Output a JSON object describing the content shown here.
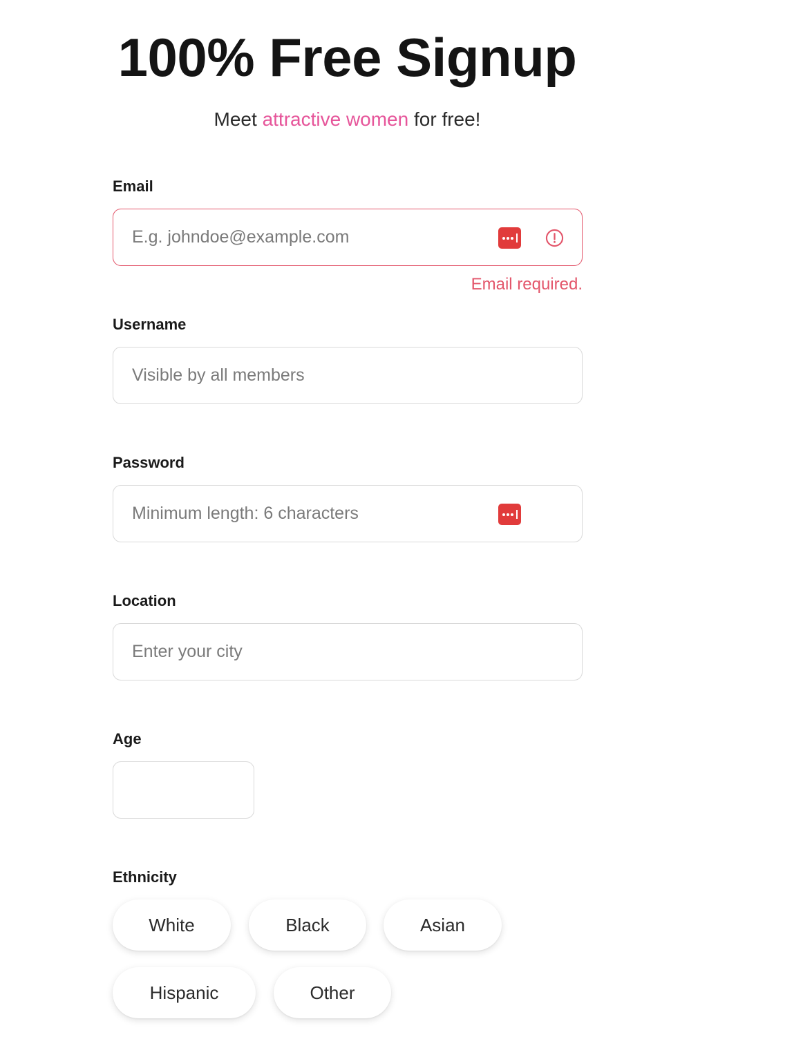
{
  "header": {
    "title": "100% Free Signup",
    "subtitle_prefix": "Meet ",
    "subtitle_accent": "attractive women",
    "subtitle_suffix": " for free!"
  },
  "form": {
    "email": {
      "label": "Email",
      "placeholder": "E.g. johndoe@example.com",
      "value": "",
      "error": "Email required."
    },
    "username": {
      "label": "Username",
      "placeholder": "Visible by all members",
      "value": ""
    },
    "password": {
      "label": "Password",
      "placeholder": "Minimum length: 6 characters",
      "value": ""
    },
    "location": {
      "label": "Location",
      "placeholder": "Enter your city",
      "value": ""
    },
    "age": {
      "label": "Age",
      "value": ""
    },
    "ethnicity": {
      "label": "Ethnicity",
      "options": [
        "White",
        "Black",
        "Asian",
        "Hispanic",
        "Other"
      ]
    }
  },
  "icons": {
    "password_manager": "password-manager-icon",
    "alert": "alert-circle-icon"
  },
  "colors": {
    "accent": "#e6559a",
    "error": "#e3566b",
    "password_manager": "#e13b3b",
    "border": "#d9d9d9"
  }
}
